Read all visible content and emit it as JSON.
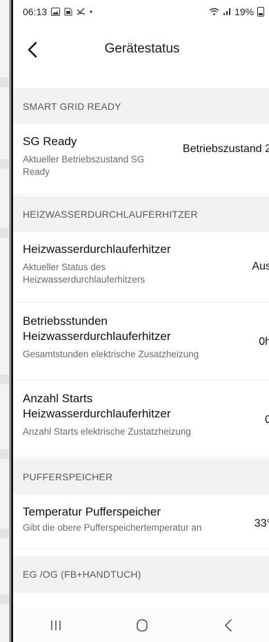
{
  "status_bar": {
    "time": "06:13",
    "battery": "19%",
    "icons_left": [
      "gallery-icon",
      "sim-icon",
      "missed-call-icon",
      "dot-icon"
    ],
    "icons_right": [
      "wifi-icon",
      "signal-icon",
      "battery-icon"
    ]
  },
  "header": {
    "title": "Gerätestatus",
    "back_icon": "chevron-left-icon"
  },
  "sections": {
    "sg": {
      "title": "SMART GRID READY"
    },
    "heiz": {
      "title": "HEIZWASSERDURCHLAUFERHITZER"
    },
    "puffer": {
      "title": "PUFFERSPEICHER"
    },
    "eg": {
      "title": "EG /OG (FB+HANDTUCH)"
    }
  },
  "rows": {
    "sg_ready": {
      "label": "SG Ready",
      "sub": "Aktueller Betriebszustand SG Ready",
      "value": "Betriebszustand 2"
    },
    "heiz_status": {
      "label": "Heizwasserdurchlauferhitzer",
      "sub": "Aktueller Status des Heizwasserdurchlauferhitzers",
      "value": "Aus"
    },
    "heiz_hours": {
      "label": "Betriebsstunden Heizwasserdurchlauferhitzer",
      "sub": "Gesamtstunden elektrische Zusatzheizung",
      "value": "0h"
    },
    "heiz_starts": {
      "label": "Anzahl Starts Heizwasserdurchlauferhitzer",
      "sub": "Anzahl Starts elektrische Zustatzheizung",
      "value": "0"
    },
    "puffer_temp": {
      "label": "Temperatur Pufferspeicher",
      "sub": "Gibt die obere Pufferspeichertemperatur an",
      "value": "33°"
    }
  },
  "nav": {
    "recent_icon": "recent-apps-icon",
    "home_icon": "home-icon",
    "back_icon": "back-icon"
  }
}
